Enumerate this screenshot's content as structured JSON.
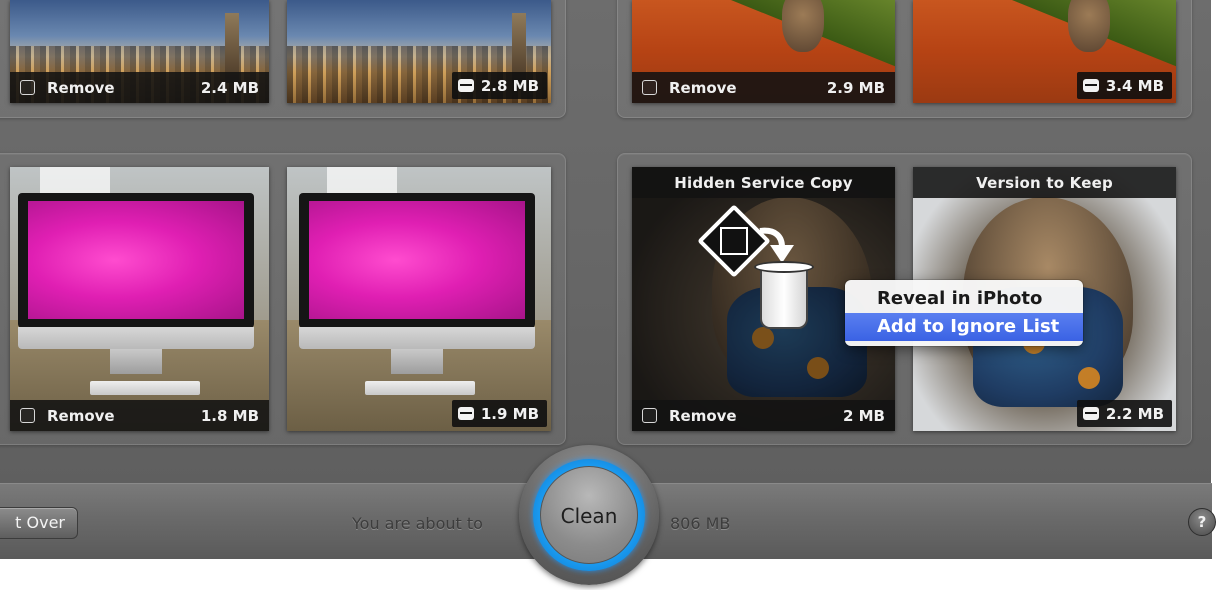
{
  "tiles": {
    "t1": {
      "action": "Remove",
      "size": "2.4 MB"
    },
    "t2": {
      "size": "2.8 MB"
    },
    "t3": {
      "action": "Remove",
      "size": "2.9 MB"
    },
    "t4": {
      "size": "3.4 MB"
    },
    "t5": {
      "action": "Remove",
      "size": "1.8 MB"
    },
    "t6": {
      "size": "1.9 MB"
    },
    "t7": {
      "title": "Hidden Service Copy",
      "action": "Remove",
      "size": "2 MB"
    },
    "t8": {
      "title": "Version to Keep",
      "size": "2.2 MB"
    }
  },
  "context_menu": {
    "items": [
      "Reveal in iPhoto",
      "Add to Ignore List"
    ],
    "selected_index": 1
  },
  "toolbar": {
    "start_over_label": "t Over",
    "about_text": "You are about to",
    "clean_label": "Clean",
    "total_size": "806 MB",
    "help_label": "?"
  },
  "colors": {
    "accent_blue": "#1b9cf2",
    "menu_selection": "#3a62e4",
    "background_gray": "#666666"
  },
  "icons": {
    "keep_badge": "drive-icon",
    "overlay": "trash-icon",
    "hidden_copy": "hidden-photo-icon",
    "arrow": "arrow-icon"
  }
}
